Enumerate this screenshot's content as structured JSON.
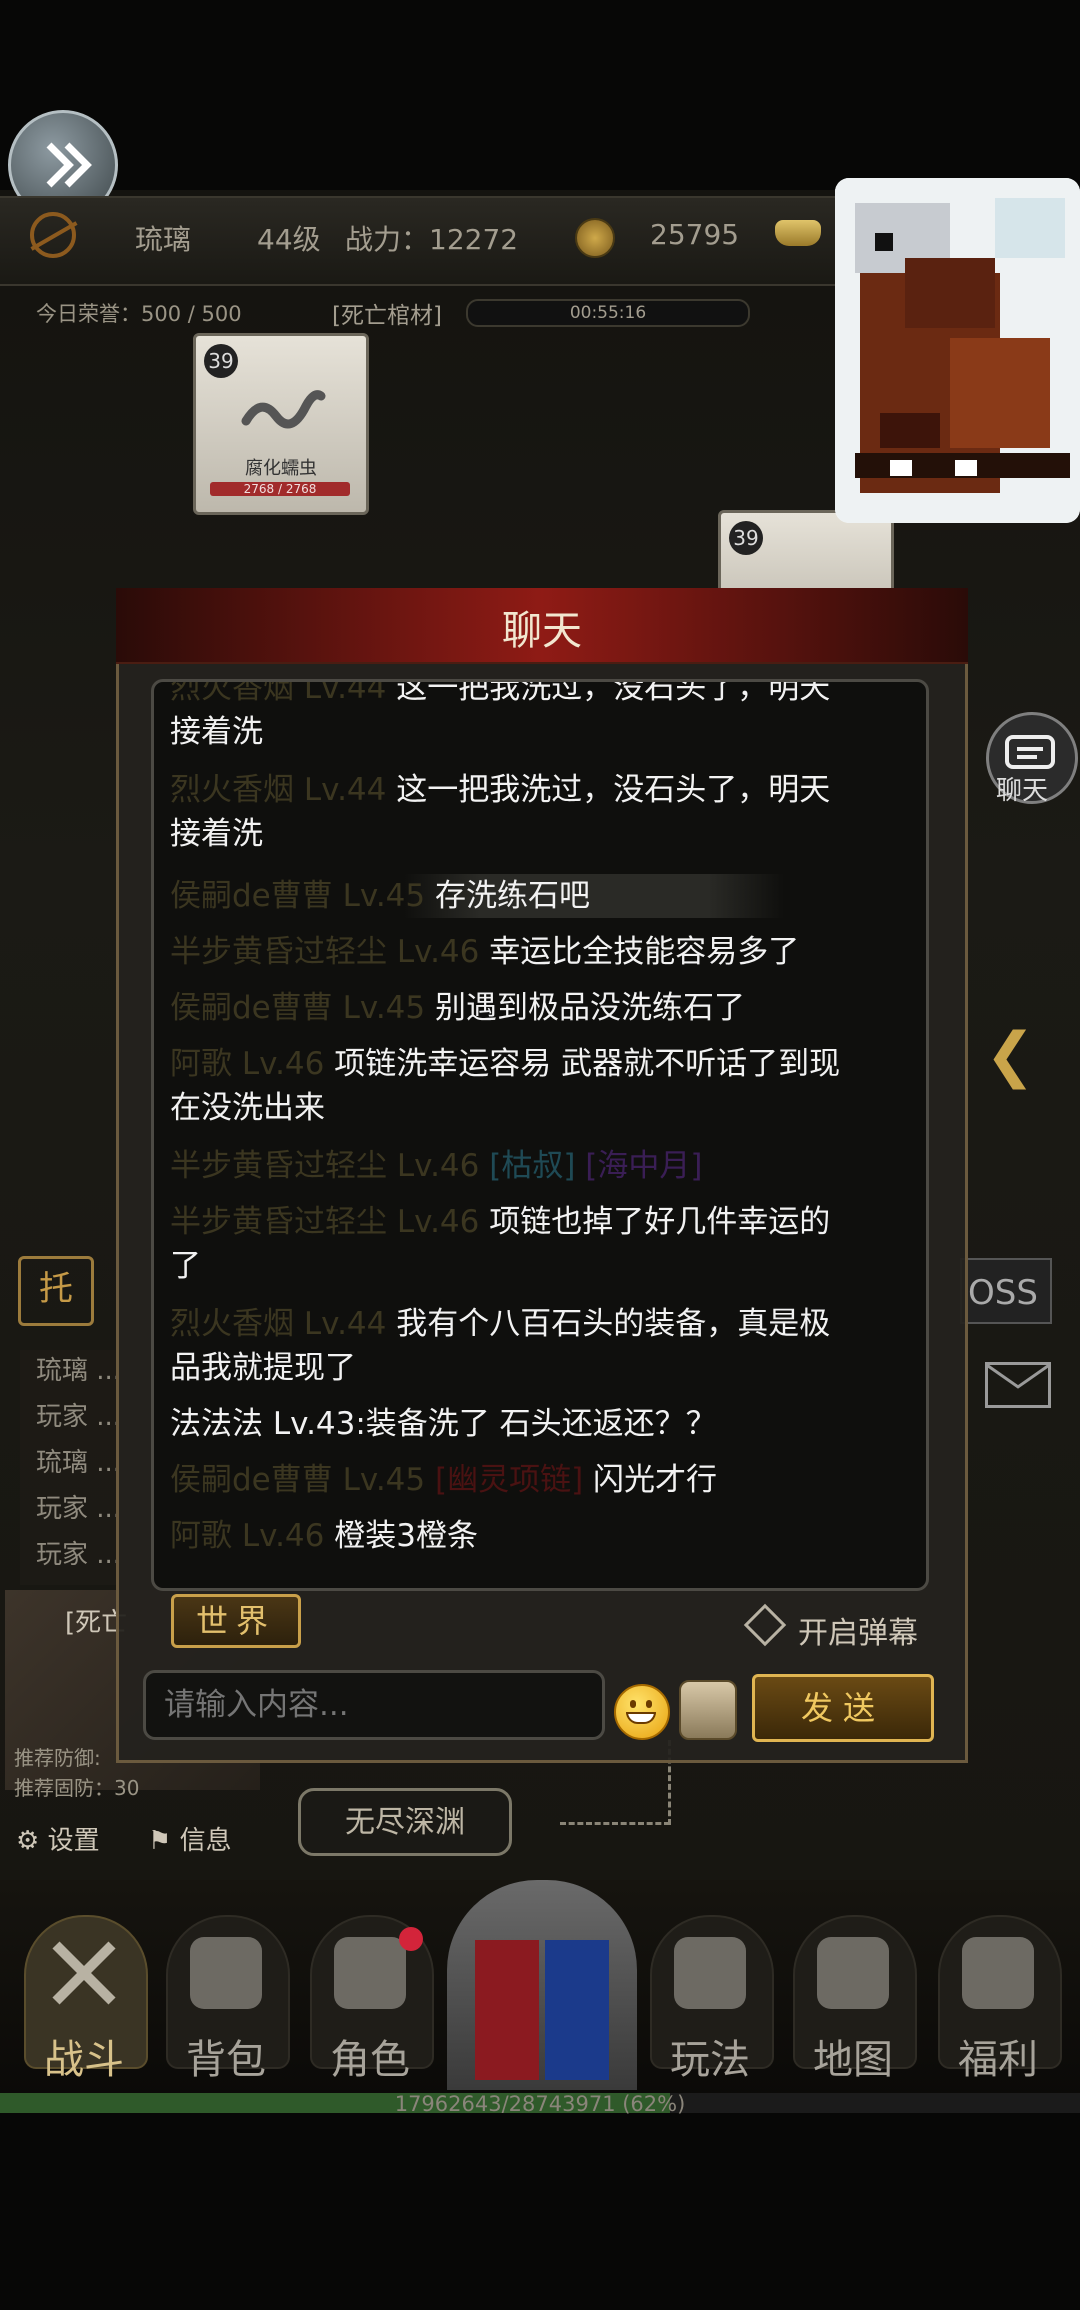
{
  "player": {
    "name": "琉璃",
    "level": "44级",
    "power": "战力：12272",
    "coins": "25795"
  },
  "honor": {
    "text": "今日荣誉：500 / 500"
  },
  "dungeon": {
    "tag": "[死亡棺材]",
    "timer": "00:55:16"
  },
  "monsters": [
    {
      "level": "39",
      "name": "腐化蠕虫",
      "hp": "2768 / 2768",
      "hp_fraction": 1.0
    },
    {
      "level": "39",
      "name": "",
      "hp": ""
    }
  ],
  "side": {
    "chat_label": "聊天",
    "boss_label": "OSS",
    "tuo_label": "托"
  },
  "log": {
    "lines": [
      "琉璃 ...",
      "玩家 ...",
      "琉璃 ...",
      "玩家 ...",
      "玩家 ..."
    ]
  },
  "map": {
    "label": "[死亡",
    "recommend_def": "推荐防御:",
    "recommend_solid": "推荐固防：30"
  },
  "settings_label": "设置",
  "info_label": "信息",
  "abyss_label": "无尽深渊",
  "chat": {
    "title": "聊天",
    "messages": [
      {
        "sender": "烈火香烟 Lv.44",
        "text": "这一把我洗过，没石头了，明天"
      },
      {
        "sender": "",
        "text": "接着洗"
      },
      {
        "sender": "烈火香烟 Lv.44",
        "text": "这一把我洗过，没石头了，明天"
      },
      {
        "sender": "",
        "text": "接着洗"
      },
      {
        "sender": "侯嗣de曹曹 Lv.45",
        "text": "存洗练石吧"
      },
      {
        "sender": "半步黄昏过轻尘 Lv.46",
        "text": "幸运比全技能容易多了"
      },
      {
        "sender": "侯嗣de曹曹 Lv.45",
        "text": "别遇到极品没洗练石了"
      },
      {
        "sender": "阿歌 Lv.46",
        "text": "项链洗幸运容易 武器就不听话了到现"
      },
      {
        "sender": "",
        "text": "在没洗出来"
      },
      {
        "sender": "半步黄昏过轻尘 Lv.46",
        "item1": "[枯叔]",
        "item2": "[海中月]"
      },
      {
        "sender": "半步黄昏过轻尘 Lv.46",
        "text": "项链也掉了好几件幸运的"
      },
      {
        "sender": "",
        "text": "了"
      },
      {
        "sender": "烈火香烟 Lv.44",
        "text": "我有个八百石头的装备，真是极"
      },
      {
        "sender": "",
        "text": "品我就提现了"
      },
      {
        "sender": "",
        "text": "法法法 Lv.43:装备洗了 石头还返还？？"
      },
      {
        "sender": "侯嗣de曹曹 Lv.45",
        "item": "[幽灵项链]",
        "text": "闪光才行"
      },
      {
        "sender": "阿歌 Lv.46",
        "text": "橙装3橙条"
      }
    ],
    "world_tab": "世界",
    "barrage_label": "开启弹幕",
    "input_placeholder": "请输入内容...",
    "send_label": "发送"
  },
  "nav": {
    "items": [
      "战斗",
      "背包",
      "角色",
      "玩法",
      "地图",
      "福利"
    ]
  },
  "exp": {
    "text": "17962643/28743971 (62%)",
    "fraction": 0.62
  }
}
